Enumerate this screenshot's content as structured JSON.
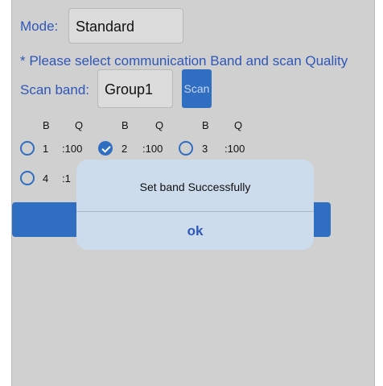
{
  "mode": {
    "label": "Mode:",
    "value": "Standard"
  },
  "notice": "* Please select communication Band and scan Quality",
  "scan_band": {
    "label": "Scan band:",
    "value": "Group1",
    "button": "Scan"
  },
  "grid": {
    "headers": [
      "B",
      "Q",
      "B",
      "Q",
      "B",
      "Q"
    ],
    "row1": [
      {
        "band": "1",
        "quality": ":100",
        "checked": false
      },
      {
        "band": "2",
        "quality": ":100",
        "checked": true
      },
      {
        "band": "3",
        "quality": ":100",
        "checked": false
      }
    ],
    "row2": [
      {
        "band": "4",
        "quality": ":1",
        "checked": false
      }
    ]
  },
  "dialog": {
    "message": "Set band Successfully",
    "ok": "ok"
  }
}
